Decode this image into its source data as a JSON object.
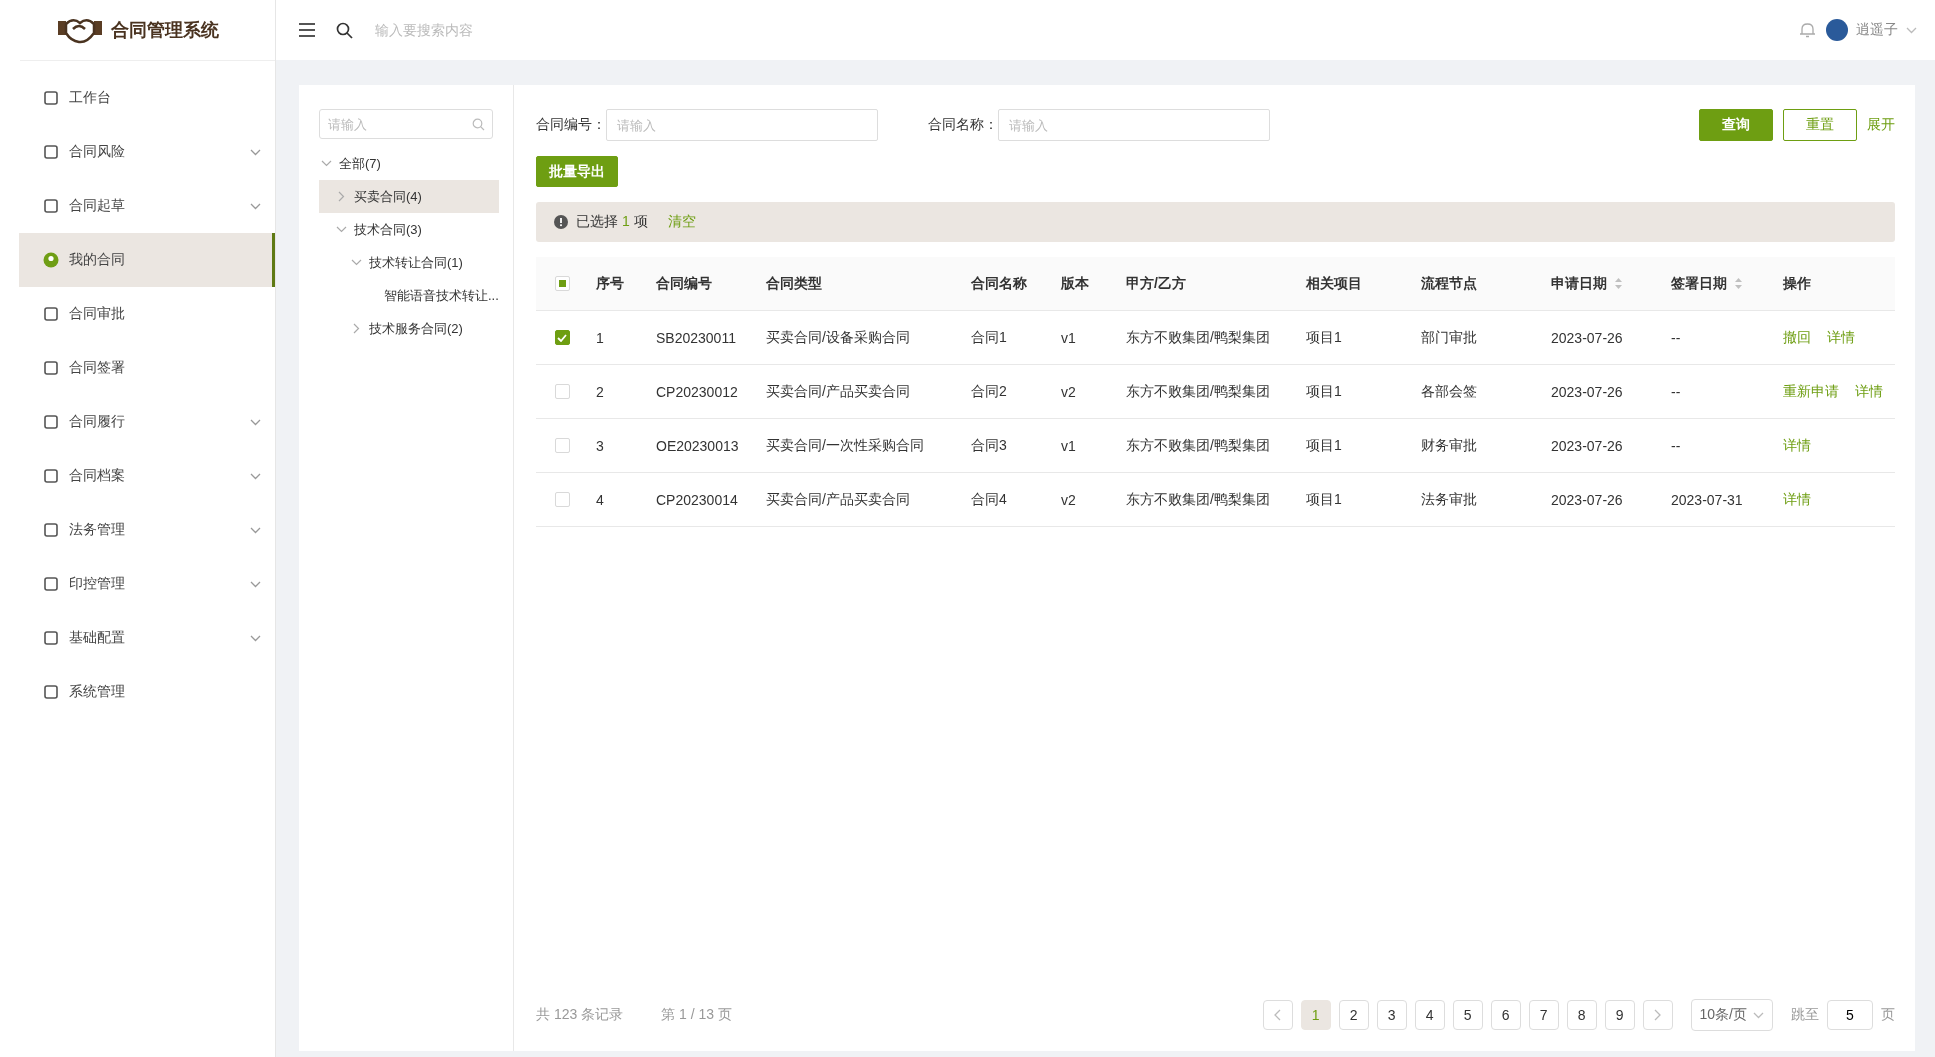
{
  "app": {
    "title": "合同管理系统"
  },
  "header": {
    "search_placeholder": "输入要搜索内容",
    "user": "逍遥子"
  },
  "sidebar": {
    "items": [
      {
        "label": "工作台",
        "expandable": false,
        "selected": false
      },
      {
        "label": "合同风险",
        "expandable": true,
        "selected": false
      },
      {
        "label": "合同起草",
        "expandable": true,
        "selected": false
      },
      {
        "label": "我的合同",
        "expandable": false,
        "selected": true
      },
      {
        "label": "合同审批",
        "expandable": false,
        "selected": false
      },
      {
        "label": "合同签署",
        "expandable": false,
        "selected": false
      },
      {
        "label": "合同履行",
        "expandable": true,
        "selected": false
      },
      {
        "label": "合同档案",
        "expandable": true,
        "selected": false
      },
      {
        "label": "法务管理",
        "expandable": true,
        "selected": false
      },
      {
        "label": "印控管理",
        "expandable": true,
        "selected": false
      },
      {
        "label": "基础配置",
        "expandable": true,
        "selected": false
      },
      {
        "label": "系统管理",
        "expandable": false,
        "selected": false
      }
    ]
  },
  "tree": {
    "search_placeholder": "请输入",
    "nodes": [
      {
        "label": "全部(7)",
        "expanded": true,
        "selected": false,
        "children": [
          {
            "label": "买卖合同(4)",
            "expanded": false,
            "selected": true
          },
          {
            "label": "技术合同(3)",
            "expanded": true,
            "selected": false,
            "children": [
              {
                "label": "技术转让合同(1)",
                "expanded": true,
                "selected": false,
                "children": [
                  {
                    "label": "智能语音技术转让...",
                    "selected": false
                  }
                ]
              },
              {
                "label": "技术服务合同(2)",
                "expanded": false,
                "selected": false
              }
            ]
          }
        ]
      }
    ]
  },
  "filters": [
    {
      "label": "合同编号：",
      "placeholder": "请输入"
    },
    {
      "label": "合同名称：",
      "placeholder": "请输入"
    }
  ],
  "buttons": {
    "query": "查询",
    "reset": "重置",
    "expand": "展开",
    "export": "批量导出"
  },
  "selection_bar": {
    "prefix": "已选择",
    "count": "1",
    "suffix": "项",
    "clear": "清空"
  },
  "table": {
    "header_checkbox": {
      "indeterminate": true
    },
    "columns": [
      {
        "label": "序号",
        "sortable": false
      },
      {
        "label": "合同编号",
        "sortable": false
      },
      {
        "label": "合同类型",
        "sortable": false
      },
      {
        "label": "合同名称",
        "sortable": false
      },
      {
        "label": "版本",
        "sortable": false
      },
      {
        "label": "甲方/乙方",
        "sortable": false
      },
      {
        "label": "相关项目",
        "sortable": false
      },
      {
        "label": "流程节点",
        "sortable": false
      },
      {
        "label": "申请日期",
        "sortable": true
      },
      {
        "label": "签署日期",
        "sortable": true
      },
      {
        "label": "操作",
        "sortable": false
      }
    ],
    "rows": [
      {
        "selected": true,
        "cells": [
          "1",
          "SB20230011",
          "买卖合同/设备采购合同",
          "合同1",
          "v1",
          "东方不败集团/鸭梨集团",
          "项目1",
          "部门审批",
          "2023-07-26",
          "--"
        ],
        "actions": [
          "撤回",
          "详情"
        ]
      },
      {
        "selected": false,
        "cells": [
          "2",
          "CP20230012",
          "买卖合同/产品买卖合同",
          "合同2",
          "v2",
          "东方不败集团/鸭梨集团",
          "项目1",
          "各部会签",
          "2023-07-26",
          "--"
        ],
        "actions": [
          "重新申请",
          "详情"
        ]
      },
      {
        "selected": false,
        "cells": [
          "3",
          "OE20230013",
          "买卖合同/一次性采购合同",
          "合同3",
          "v1",
          "东方不败集团/鸭梨集团",
          "项目1",
          "财务审批",
          "2023-07-26",
          "--"
        ],
        "actions": [
          "详情"
        ]
      },
      {
        "selected": false,
        "cells": [
          "4",
          "CP20230014",
          "买卖合同/产品买卖合同",
          "合同4",
          "v2",
          "东方不败集团/鸭梨集团",
          "项目1",
          "法务审批",
          "2023-07-26",
          "2023-07-31"
        ],
        "actions": [
          "详情"
        ]
      }
    ]
  },
  "pagination": {
    "total": "共 123 条记录",
    "page_info": "第 1 / 13 页",
    "pages": [
      {
        "label": "1",
        "selected": true
      },
      {
        "label": "2",
        "selected": false
      },
      {
        "label": "3",
        "selected": false
      },
      {
        "label": "4",
        "selected": false
      },
      {
        "label": "5",
        "selected": false
      },
      {
        "label": "6",
        "selected": false
      },
      {
        "label": "7",
        "selected": false
      },
      {
        "label": "8",
        "selected": false
      },
      {
        "label": "9",
        "selected": false
      }
    ],
    "page_size": "10条/页",
    "jump_label": "跳至",
    "jump_value": "5",
    "jump_suffix": "页"
  }
}
